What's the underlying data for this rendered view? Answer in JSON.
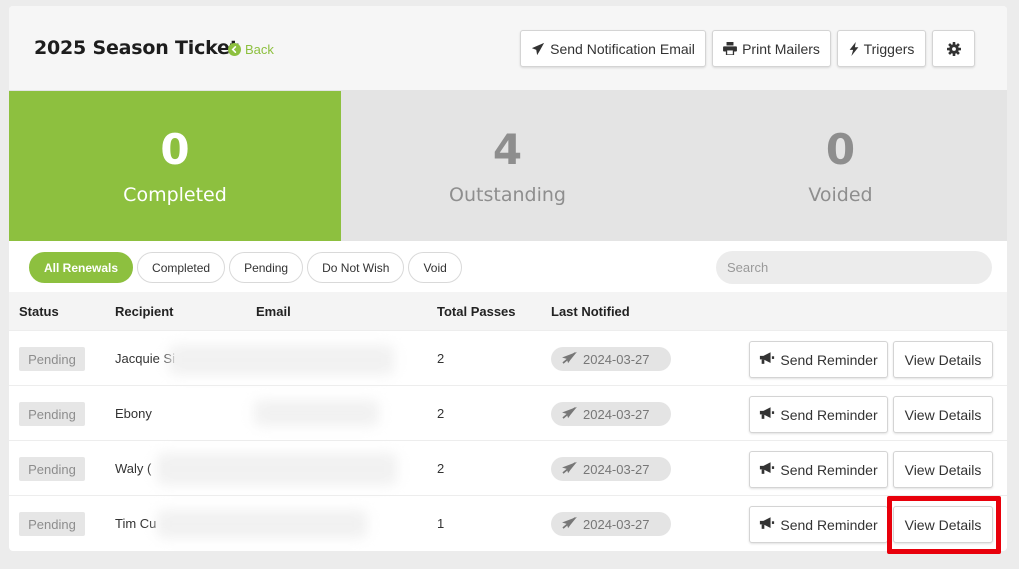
{
  "header": {
    "title": "2025 Season Ticket",
    "back_label": "Back",
    "buttons": {
      "send_notification": "Send Notification Email",
      "print_mailers": "Print Mailers",
      "triggers": "Triggers"
    }
  },
  "stats": [
    {
      "value": "0",
      "label": "Completed"
    },
    {
      "value": "4",
      "label": "Outstanding"
    },
    {
      "value": "0",
      "label": "Voided"
    }
  ],
  "filters": [
    "All Renewals",
    "Completed",
    "Pending",
    "Do Not Wish",
    "Void"
  ],
  "search": {
    "placeholder": "Search"
  },
  "table": {
    "headers": {
      "status": "Status",
      "recipient": "Recipient",
      "email": "Email",
      "total_passes": "Total Passes",
      "last_notified": "Last Notified"
    },
    "rows": [
      {
        "status": "Pending",
        "recipient": "Jacquie Si",
        "passes": "2",
        "last_notified": "2024-03-27",
        "remind": "Send Reminder",
        "details": "View Details"
      },
      {
        "status": "Pending",
        "recipient": "Ebony",
        "passes": "2",
        "last_notified": "2024-03-27",
        "remind": "Send Reminder",
        "details": "View Details"
      },
      {
        "status": "Pending",
        "recipient": "Waly (",
        "passes": "2",
        "last_notified": "2024-03-27",
        "remind": "Send Reminder",
        "details": "View Details"
      },
      {
        "status": "Pending",
        "recipient": "Tim Cu",
        "passes": "1",
        "last_notified": "2024-03-27",
        "remind": "Send Reminder",
        "details": "View Details"
      }
    ]
  },
  "colors": {
    "accent": "#8dc03f",
    "highlight": "#e8000b"
  }
}
